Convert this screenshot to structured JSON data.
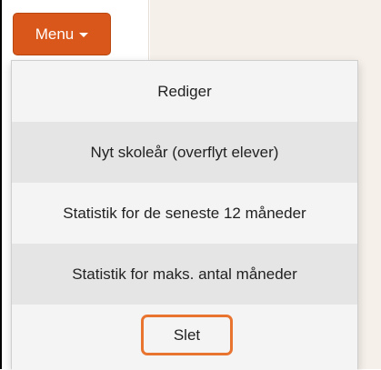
{
  "menu_button": {
    "label": "Menu",
    "icon": "caret-down-icon"
  },
  "dropdown": {
    "items": [
      {
        "label": "Rediger"
      },
      {
        "label": "Nyt skoleår (overflyt elever)"
      },
      {
        "label": "Statistik for de seneste 12 måneder"
      },
      {
        "label": "Statistik for maks. antal måneder"
      },
      {
        "label": "Slet",
        "highlighted": true
      }
    ]
  },
  "colors": {
    "accent": "#d9571a",
    "highlight_outline": "#e8742f",
    "background_panel": "#f6f0ea"
  }
}
